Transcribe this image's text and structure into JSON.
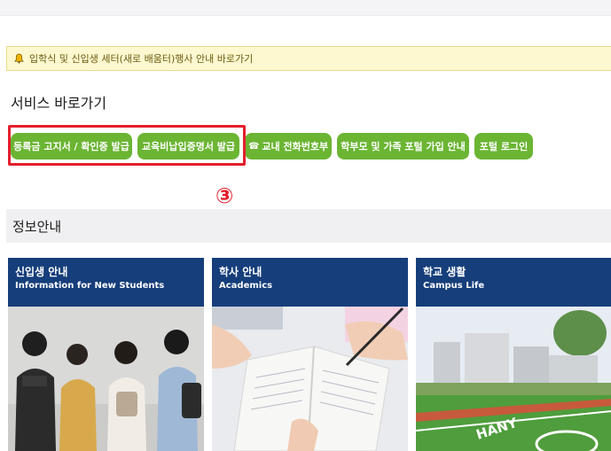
{
  "notice": {
    "text": "입학식 및 신입생 세터(새로 배움터)행사 안내 바로가기",
    "icon": "bell-icon"
  },
  "services": {
    "title": "서비스 바로가기",
    "buttons": [
      {
        "label": "등록금 고지서 / 확인증 발급"
      },
      {
        "label": "교육비납입증명서 발급"
      },
      {
        "label": "교내 전화번호부",
        "icon": "phone-icon"
      },
      {
        "label": "학부모 및 가족 포털 가입 안내"
      },
      {
        "label": "포털 로그인"
      }
    ],
    "callout_number": "③"
  },
  "info": {
    "title": "정보안내",
    "cards": [
      {
        "title_ko": "신입생 안내",
        "title_en": "Information for New Students"
      },
      {
        "title_ko": "학사 안내",
        "title_en": "Academics"
      },
      {
        "title_ko": "학교 생활",
        "title_en": "Campus Life"
      }
    ]
  },
  "colors": {
    "button_green": "#6bb533",
    "card_navy": "#163e7a",
    "highlight_red": "#e41f2c",
    "notice_bg": "#fdf8cf"
  }
}
